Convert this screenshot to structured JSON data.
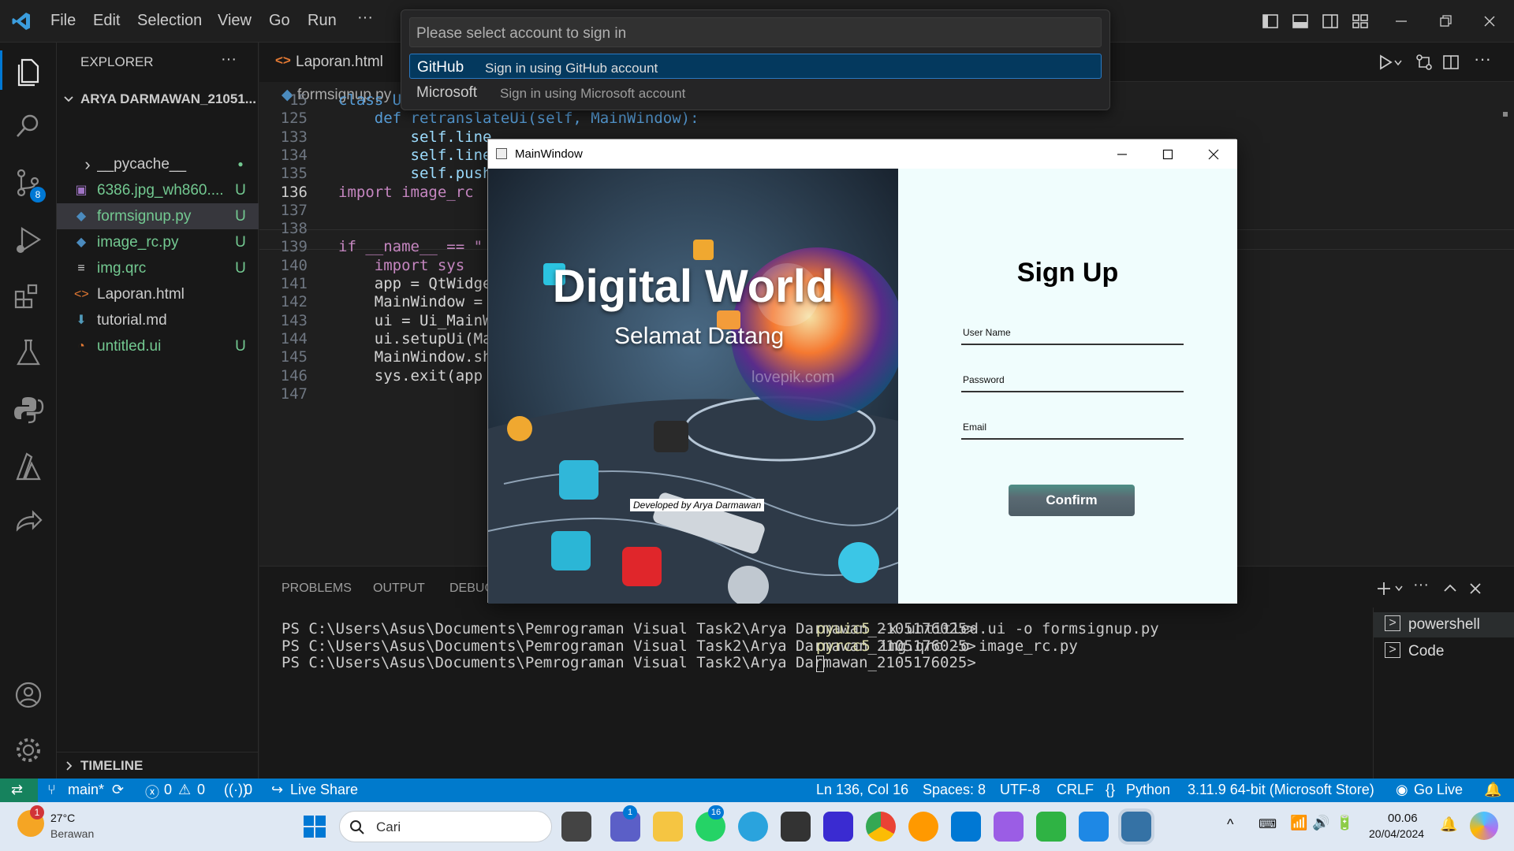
{
  "titlebar": {
    "menu": [
      "File",
      "Edit",
      "Selection",
      "View",
      "Go",
      "Run",
      "···"
    ]
  },
  "quickpick": {
    "placeholder": "Please select account to sign in",
    "items": [
      {
        "title": "GitHub",
        "desc": "Sign in using GitHub account"
      },
      {
        "title": "Microsoft",
        "desc": "Sign in using Microsoft account"
      }
    ]
  },
  "activity": {
    "scm_badge": "8"
  },
  "sidebar": {
    "header": "EXPLORER",
    "more": "···",
    "root": "ARYA DARMAWAN_21051...",
    "items": [
      {
        "icon": "chevron-right",
        "name": "__pycache__",
        "status": "●",
        "color": "#cccccc",
        "status_color": "#73c991"
      },
      {
        "icon": "image",
        "name": "6386.jpg_wh860....",
        "status": "U",
        "color": "#73c991",
        "status_color": "#73c991"
      },
      {
        "icon": "python",
        "name": "formsignup.py",
        "status": "U",
        "color": "#73c991",
        "status_color": "#73c991"
      },
      {
        "icon": "python",
        "name": "image_rc.py",
        "status": "U",
        "color": "#73c991",
        "status_color": "#73c991"
      },
      {
        "icon": "lines",
        "name": "img.qrc",
        "status": "U",
        "color": "#73c991",
        "status_color": "#73c991"
      },
      {
        "icon": "html",
        "name": "Laporan.html",
        "status": "",
        "color": "#cccccc",
        "status_color": "#cccccc"
      },
      {
        "icon": "markdown",
        "name": "tutorial.md",
        "status": "",
        "color": "#cccccc",
        "status_color": "#cccccc"
      },
      {
        "icon": "rss",
        "name": "untitled.ui",
        "status": "U",
        "color": "#73c991",
        "status_color": "#73c991"
      }
    ],
    "timeline": "TIMELINE"
  },
  "editor": {
    "tab": "Laporan.html",
    "breadcrumb": "formsignup.py",
    "lines": [
      {
        "n": "15",
        "text": "class Ui_MainWindow(object):"
      },
      {
        "n": "125",
        "text": "    def retranslateUi(self, MainWindow):"
      },
      {
        "n": "133",
        "text": "        self.line"
      },
      {
        "n": "134",
        "text": "        self.line"
      },
      {
        "n": "135",
        "text": "        self.push"
      },
      {
        "n": "136",
        "text": "import image_rc"
      },
      {
        "n": "137",
        "text": ""
      },
      {
        "n": "138",
        "text": ""
      },
      {
        "n": "139",
        "text": "if __name__ == \""
      },
      {
        "n": "140",
        "text": "    import sys"
      },
      {
        "n": "141",
        "text": "    app = QtWidge"
      },
      {
        "n": "142",
        "text": "    MainWindow ="
      },
      {
        "n": "143",
        "text": "    ui = Ui_MainW"
      },
      {
        "n": "144",
        "text": "    ui.setupUi(Ma"
      },
      {
        "n": "145",
        "text": "    MainWindow.sh"
      },
      {
        "n": "146",
        "text": "    sys.exit(app"
      },
      {
        "n": "147",
        "text": ""
      }
    ]
  },
  "panel": {
    "tabs": [
      "PROBLEMS",
      "OUTPUT",
      "DEBUG"
    ],
    "terminal": [
      {
        "prompt": "PS C:\\Users\\Asus\\Documents\\Pemrograman Visual Task2\\Arya Darmawan_2105176025>",
        "cmd": "pyuic5",
        "args": " -x untitled.ui -o formsignup.py"
      },
      {
        "prompt": "PS C:\\Users\\Asus\\Documents\\Pemrograman Visual Task2\\Arya Darmawan_2105176025>",
        "cmd": "pyrcc5",
        "args": " img.qrc -o image_rc.py"
      },
      {
        "prompt": "PS C:\\Users\\Asus\\Documents\\Pemrograman Visual Task2\\Arya Darmawan_2105176025>",
        "cmd": "",
        "args": ""
      }
    ],
    "terminals": [
      "powershell",
      "Code"
    ]
  },
  "mainwindow": {
    "title": "MainWindow",
    "banner_title": "Digital World",
    "banner_sub": "Selamat Datang",
    "watermark": "lovepik.com",
    "credit": "Developed by Arya Darmawan",
    "form_title": "Sign Up",
    "fields": [
      "User Name",
      "Password",
      "Email"
    ],
    "confirm": "Confirm"
  },
  "status": {
    "branch": "main*",
    "errors": "0",
    "warnings": "0",
    "ports": "0",
    "liveshare": "Live Share",
    "position": "Ln 136, Col 16",
    "spaces": "Spaces: 8",
    "encoding": "UTF-8",
    "eol": "CRLF",
    "language": "Python",
    "interpreter": "3.11.9 64-bit (Microsoft Store)",
    "golive": "Go Live"
  },
  "taskbar": {
    "weather_temp": "27°C",
    "weather_desc": "Berawan",
    "weather_badge": "1",
    "search": "Cari",
    "teams_badge": "1",
    "whatsapp_badge": "16",
    "time": "00.06",
    "date": "20/04/2024"
  }
}
